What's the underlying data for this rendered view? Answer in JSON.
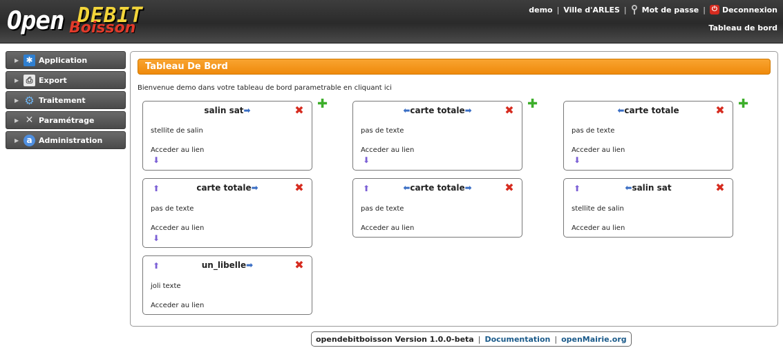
{
  "header": {
    "logo": {
      "open": "Open",
      "debit": "DEBIT",
      "boisson": "Boisson"
    },
    "user": "demo",
    "collectivite": "Ville d'ARLES",
    "password_label": "Mot de passe",
    "logout_label": "Deconnexion",
    "dashboard_label": "Tableau de bord"
  },
  "sidebar": {
    "items": [
      {
        "label": "Application",
        "icon": "asterisk-icon"
      },
      {
        "label": "Export",
        "icon": "printer-icon"
      },
      {
        "label": "Traitement",
        "icon": "gear-icon"
      },
      {
        "label": "Paramétrage",
        "icon": "tools-icon"
      },
      {
        "label": "Administration",
        "icon": "admin-icon"
      }
    ]
  },
  "main": {
    "title": "Tableau De Bord",
    "welcome": "Bienvenue demo dans votre tableau de bord parametrable en cliquant ici",
    "widgets": [
      {
        "title": "salin sat",
        "text": "stellite de salin",
        "link": "Acceder au lien"
      },
      {
        "title": "carte totale",
        "text": "pas de texte",
        "link": "Acceder au lien"
      },
      {
        "title": "carte totale",
        "text": "pas de texte",
        "link": "Acceder au lien"
      },
      {
        "title": "carte totale",
        "text": "pas de texte",
        "link": "Acceder au lien"
      },
      {
        "title": "carte totale",
        "text": "pas de texte",
        "link": "Acceder au lien"
      },
      {
        "title": "salin sat",
        "text": "stellite de salin",
        "link": "Acceder au lien"
      },
      {
        "title": "un_libelle",
        "text": "joli texte",
        "link": "Acceder au lien"
      }
    ]
  },
  "footer": {
    "version": "opendebitboisson Version 1.0.0-beta",
    "documentation": "Documentation",
    "openmairie": "openMairie.org"
  },
  "colors": {
    "accent": "#ef8a0c",
    "header_bg": "#333333",
    "link": "#1a5a8a",
    "close": "#d62b1f",
    "add": "#3cae2a"
  }
}
